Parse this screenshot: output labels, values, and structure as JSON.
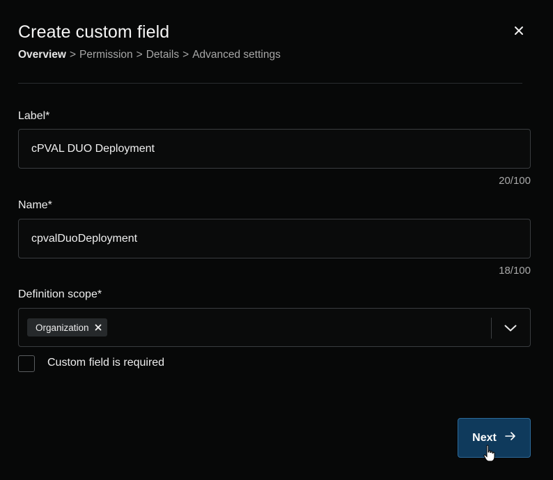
{
  "dialog": {
    "title": "Create custom field",
    "close_icon": "close-icon"
  },
  "breadcrumb": {
    "items": [
      "Overview",
      "Permission",
      "Details",
      "Advanced settings"
    ],
    "separator": ">",
    "active_index": 0
  },
  "form": {
    "label": {
      "label": "Label*",
      "value": "cPVAL DUO Deployment",
      "counter": "20/100"
    },
    "name": {
      "label": "Name*",
      "value": "cpvalDuoDeployment",
      "counter": "18/100"
    },
    "scope": {
      "label": "Definition scope*",
      "chips": [
        "Organization"
      ],
      "chip_remove_icon": "close-icon",
      "dropdown_icon": "chevron-down-icon"
    },
    "required": {
      "label": "Custom field is required",
      "checked": false
    }
  },
  "actions": {
    "next_label": "Next",
    "next_icon": "arrow-right-icon"
  },
  "colors": {
    "background": "#070808",
    "primary_button": "#0f3a5c",
    "primary_border": "#2d6a99",
    "input_border": "#3a3d40"
  }
}
